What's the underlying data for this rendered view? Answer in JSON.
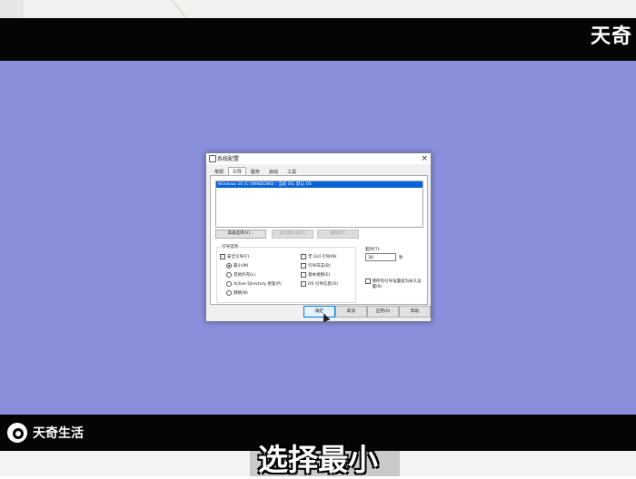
{
  "watermark": {
    "top_logo": "天奇",
    "bottom_logo": "天奇生活"
  },
  "subtitle": "选择最小",
  "dialog": {
    "title": "系统配置",
    "close_glyph": "×",
    "tabs": [
      "常规",
      "引导",
      "服务",
      "启动",
      "工具"
    ],
    "active_tab_index": 1,
    "os_list": [
      "Windows 10 (C:\\WINDOWS) : 当前 OS; 默认 OS"
    ],
    "buttons": {
      "advanced": "高级选项(V)...",
      "set_default": "设为默认值(D)",
      "delete": "删除(D)"
    },
    "boot_options": {
      "title": "引导选项",
      "safe_boot": "安全引导(F)",
      "safe_boot_checked": true,
      "minimal": "最小(M)",
      "minimal_selected": true,
      "alt_shell": "其他外壳(L)",
      "ad_repair": "Active Directory 修复(P)",
      "network": "网络(N)",
      "no_gui": "无 GUI 引导(N)",
      "boot_log": "引导日志(B)",
      "base_video": "基本视频(E)",
      "os_boot_info": "OS 引导信息(O)"
    },
    "timeout": {
      "label": "超时(T):",
      "value": "30",
      "unit": "秒"
    },
    "make_permanent": "使所有引导设置成为永久设置(K)",
    "footer": {
      "ok": "确定",
      "cancel": "取消",
      "apply": "应用(A)",
      "help": "帮助"
    }
  }
}
